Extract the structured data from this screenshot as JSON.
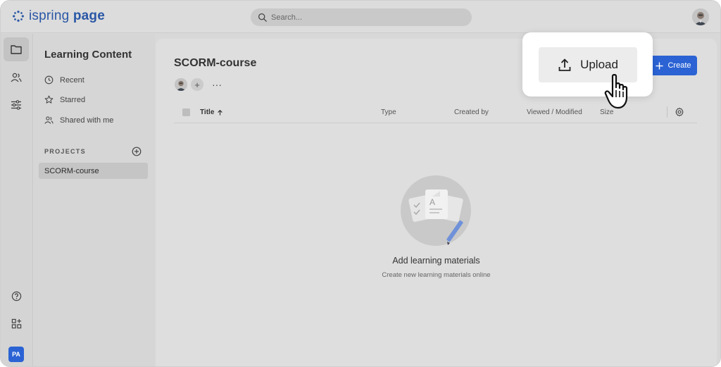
{
  "app": {
    "logo_text_regular": "ispring ",
    "logo_text_bold": "page",
    "brand_color": "#2a57a6",
    "accent_color": "#2b63d4"
  },
  "search": {
    "placeholder": "Search..."
  },
  "rail": {
    "items": [
      {
        "icon": "folder-icon",
        "active": true
      },
      {
        "icon": "users-icon",
        "active": false
      },
      {
        "icon": "sliders-icon",
        "active": false
      }
    ],
    "bottom_items": [
      {
        "icon": "help-icon"
      },
      {
        "icon": "apps-add-icon"
      }
    ],
    "user_initials": "PA"
  },
  "sidebar": {
    "title": "Learning Content",
    "items": [
      {
        "label": "Recent",
        "icon": "clock-icon"
      },
      {
        "label": "Starred",
        "icon": "star-icon"
      },
      {
        "label": "Shared with me",
        "icon": "shared-users-icon"
      }
    ],
    "projects_heading": "PROJECTS",
    "projects": [
      {
        "label": "SCORM-course",
        "selected": true
      }
    ]
  },
  "main": {
    "title": "SCORM-course",
    "more_label": "···",
    "add_member_label": "+",
    "create_label": "Create",
    "upload_label": "Upload",
    "table": {
      "columns": [
        "Title",
        "Type",
        "Created by",
        "Viewed / Modified",
        "Size"
      ],
      "sort_column": "Title",
      "sort_direction": "ascending"
    },
    "empty_state": {
      "title": "Add learning materials",
      "subtitle": "Create new learning materials online"
    }
  }
}
